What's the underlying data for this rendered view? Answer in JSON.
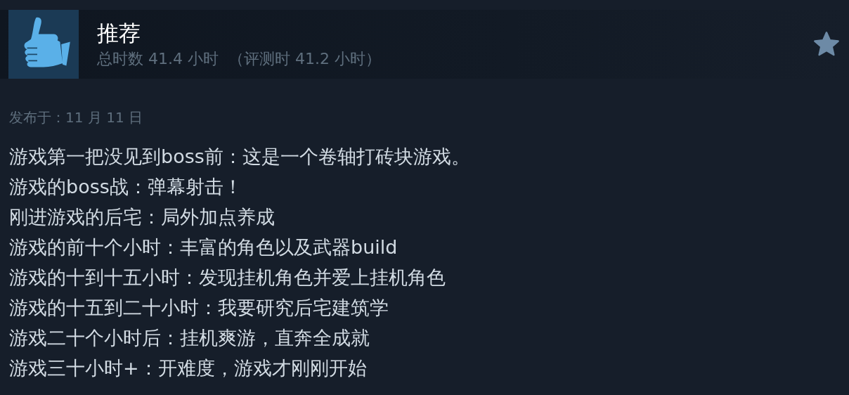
{
  "review": {
    "recommended": true,
    "title": "推荐",
    "hours": "总时数 41.4 小时",
    "hours_at_review": "（评测时 41.2 小时）",
    "posted": "发布于：11 月 11 日",
    "lines": [
      "游戏第一把没见到boss前：这是一个卷轴打砖块游戏。",
      "游戏的boss战：弹幕射击！",
      "刚进游戏的后宅：局外加点养成",
      "游戏的前十个小时：丰富的角色以及武器build",
      "游戏的十到十五小时：发现挂机角色并爱上挂机角色",
      "游戏的十五到二十小时：我要研究后宅建筑学",
      "游戏二十个小时后：挂机爽游，直奔全成就",
      "游戏三十小时+：开难度，游戏才刚刚开始"
    ]
  }
}
